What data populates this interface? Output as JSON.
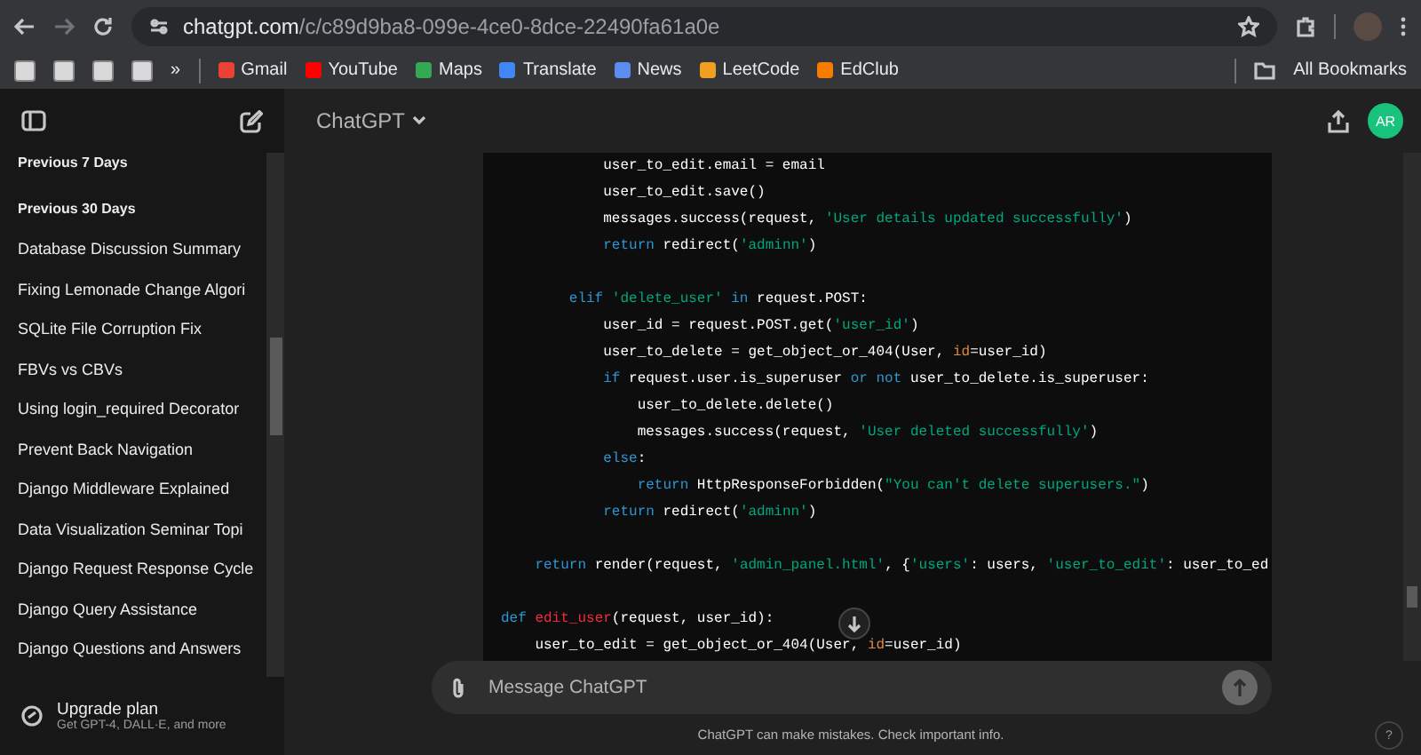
{
  "browser": {
    "url_host": "chatgpt.com",
    "url_path": "/c/c89d9ba8-099e-4ce0-8dce-22490fa61a0e",
    "overflow": "»",
    "all_bookmarks": "All Bookmarks",
    "bookmarks": [
      {
        "label": "Gmail",
        "color": "#ea4335"
      },
      {
        "label": "YouTube",
        "color": "#ff0000"
      },
      {
        "label": "Maps",
        "color": "#34a853"
      },
      {
        "label": "Translate",
        "color": "#4285f4"
      },
      {
        "label": "News",
        "color": "#5a8dee"
      },
      {
        "label": "LeetCode",
        "color": "#f0a020"
      },
      {
        "label": "EdClub",
        "color": "#f57c00"
      }
    ]
  },
  "sidebar": {
    "groups": [
      {
        "heading": "Previous 7 Days"
      },
      {
        "heading": "Previous 30 Days",
        "items": [
          "Database Discussion Summary",
          "Fixing Lemonade Change Algori",
          "SQLite File Corruption Fix",
          "FBVs vs CBVs",
          "Using login_required Decorator",
          "Prevent Back Navigation",
          "Django Middleware Explained",
          "Data Visualization Seminar Topi",
          "Django Request Response Cycle",
          "Django Query Assistance",
          "Django Questions and Answers"
        ]
      }
    ],
    "upgrade": {
      "title": "Upgrade plan",
      "subtitle": "Get GPT-4, DALL·E, and more"
    }
  },
  "header": {
    "model": "ChatGPT",
    "avatar": "AR"
  },
  "code": [
    {
      "kind": "code",
      "tokens": [
        {
          "kind": "plain",
          "t": "            user_to_edit.email = email"
        }
      ]
    },
    {
      "kind": "code",
      "tokens": [
        {
          "kind": "plain",
          "t": "            user_to_edit.save()"
        }
      ]
    },
    {
      "kind": "code",
      "tokens": [
        {
          "kind": "plain",
          "t": "            messages.success(request, "
        },
        {
          "kind": "str",
          "t": "'User details updated successfully'"
        },
        {
          "kind": "plain",
          "t": ")"
        }
      ]
    },
    {
      "kind": "code",
      "tokens": [
        {
          "kind": "kw",
          "t": "            return"
        },
        {
          "kind": "plain",
          "t": " redirect("
        },
        {
          "kind": "str",
          "t": "'adminn'"
        },
        {
          "kind": "plain",
          "t": ")"
        }
      ]
    },
    {
      "kind": "blank"
    },
    {
      "kind": "code",
      "tokens": [
        {
          "kind": "kw",
          "t": "        elif"
        },
        {
          "kind": "str",
          "t": " 'delete_user' "
        },
        {
          "kind": "kw",
          "t": "in"
        },
        {
          "kind": "plain",
          "t": " request.POST:"
        }
      ]
    },
    {
      "kind": "code",
      "tokens": [
        {
          "kind": "plain",
          "t": "            user_id = request.POST.get("
        },
        {
          "kind": "str",
          "t": "'user_id'"
        },
        {
          "kind": "plain",
          "t": ")"
        }
      ]
    },
    {
      "kind": "code",
      "tokens": [
        {
          "kind": "plain",
          "t": "            user_to_delete = get_object_or_404(User, "
        },
        {
          "kind": "arg",
          "t": "id"
        },
        {
          "kind": "plain",
          "t": "=user_id)"
        }
      ]
    },
    {
      "kind": "code",
      "tokens": [
        {
          "kind": "kw",
          "t": "            if"
        },
        {
          "kind": "plain",
          "t": " request.user.is_superuser "
        },
        {
          "kind": "kw",
          "t": "or not"
        },
        {
          "kind": "plain",
          "t": " user_to_delete.is_superuser:"
        }
      ]
    },
    {
      "kind": "code",
      "tokens": [
        {
          "kind": "plain",
          "t": "                user_to_delete.delete()"
        }
      ]
    },
    {
      "kind": "code",
      "tokens": [
        {
          "kind": "plain",
          "t": "                messages.success(request, "
        },
        {
          "kind": "str",
          "t": "'User deleted successfully'"
        },
        {
          "kind": "plain",
          "t": ")"
        }
      ]
    },
    {
      "kind": "code",
      "tokens": [
        {
          "kind": "kw",
          "t": "            else"
        },
        {
          "kind": "plain",
          "t": ":"
        }
      ]
    },
    {
      "kind": "code",
      "tokens": [
        {
          "kind": "kw",
          "t": "                return"
        },
        {
          "kind": "plain",
          "t": " HttpResponseForbidden("
        },
        {
          "kind": "str",
          "t": "\"You can't delete superusers.\""
        },
        {
          "kind": "plain",
          "t": ")"
        }
      ]
    },
    {
      "kind": "code",
      "tokens": [
        {
          "kind": "kw",
          "t": "            return"
        },
        {
          "kind": "plain",
          "t": " redirect("
        },
        {
          "kind": "str",
          "t": "'adminn'"
        },
        {
          "kind": "plain",
          "t": ")"
        }
      ]
    },
    {
      "kind": "blank"
    },
    {
      "kind": "code",
      "tokens": [
        {
          "kind": "kw",
          "t": "    return"
        },
        {
          "kind": "plain",
          "t": " render(request, "
        },
        {
          "kind": "str",
          "t": "'admin_panel.html'"
        },
        {
          "kind": "plain",
          "t": ", {"
        },
        {
          "kind": "str",
          "t": "'users'"
        },
        {
          "kind": "plain",
          "t": ": users, "
        },
        {
          "kind": "str",
          "t": "'user_to_edit'"
        },
        {
          "kind": "plain",
          "t": ": user_to_ed"
        }
      ]
    },
    {
      "kind": "blank"
    },
    {
      "kind": "code",
      "tokens": [
        {
          "kind": "kw",
          "t": "def"
        },
        {
          "kind": "fn",
          "t": " edit_user"
        },
        {
          "kind": "plain",
          "t": "(request, user_id):"
        }
      ]
    },
    {
      "kind": "code",
      "tokens": [
        {
          "kind": "plain",
          "t": "    user_to_edit = get_object_or_404(User, "
        },
        {
          "kind": "arg",
          "t": "id"
        },
        {
          "kind": "plain",
          "t": "=user_id)"
        }
      ]
    }
  ],
  "composer": {
    "placeholder": "Message ChatGPT"
  },
  "disclaimer": "ChatGPT can make mistakes. Check important info.",
  "help": "?"
}
